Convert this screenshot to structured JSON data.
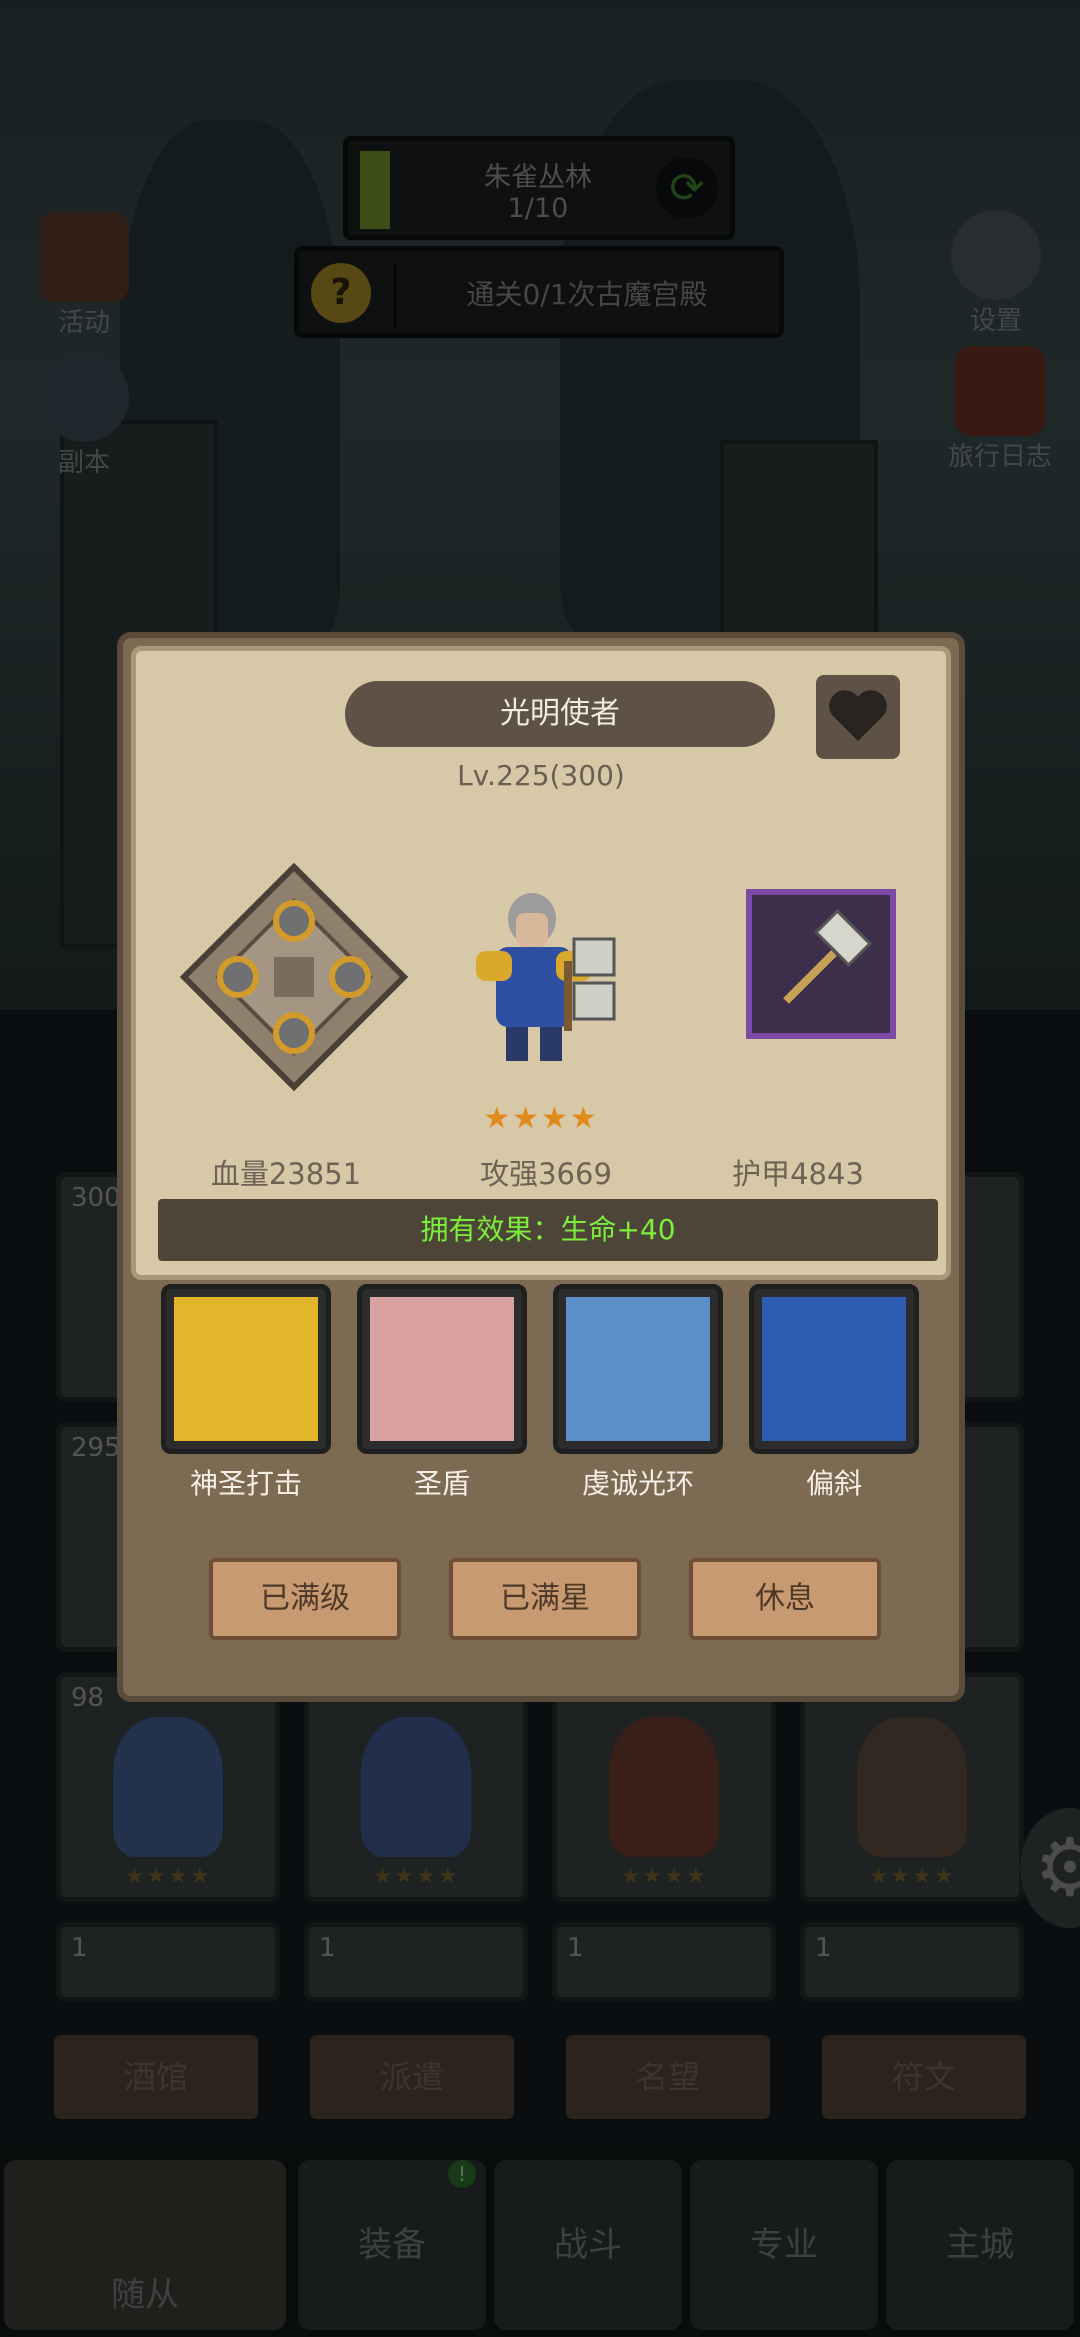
{
  "top_hud": {
    "zone_name": "朱雀丛林",
    "zone_progress": "1/10",
    "quest_text": "通关0/1次古魔宫殿",
    "quest_icon": "?"
  },
  "side_buttons": {
    "activity": "活动",
    "dungeon": "副本",
    "settings": "设置",
    "travel_log": "旅行日志"
  },
  "grid_levels": [
    "300",
    "295",
    "98",
    "1",
    "1",
    "1",
    "1"
  ],
  "sub_tabs": [
    "酒馆",
    "派遣",
    "名望",
    "符文"
  ],
  "bottom_nav": [
    "随从",
    "装备",
    "战斗",
    "专业",
    "主城"
  ],
  "bottom_nav_badge": "!",
  "modal": {
    "hero_name": "光明使者",
    "level_text": "Lv.225(300)",
    "stars": "★★★★",
    "stats": {
      "hp": "血量23851",
      "attack": "攻强3669",
      "armor": "护甲4843"
    },
    "effect": "拥有效果：生命+40",
    "skills": [
      "神圣打击",
      "圣盾",
      "虔诚光环",
      "偏斜"
    ],
    "actions": [
      "已满级",
      "已满星",
      "休息"
    ]
  },
  "colors": {
    "effect_green": "#7bef3a",
    "star_orange": "#e08a1c",
    "weapon_frame": "#7b4aa5"
  }
}
